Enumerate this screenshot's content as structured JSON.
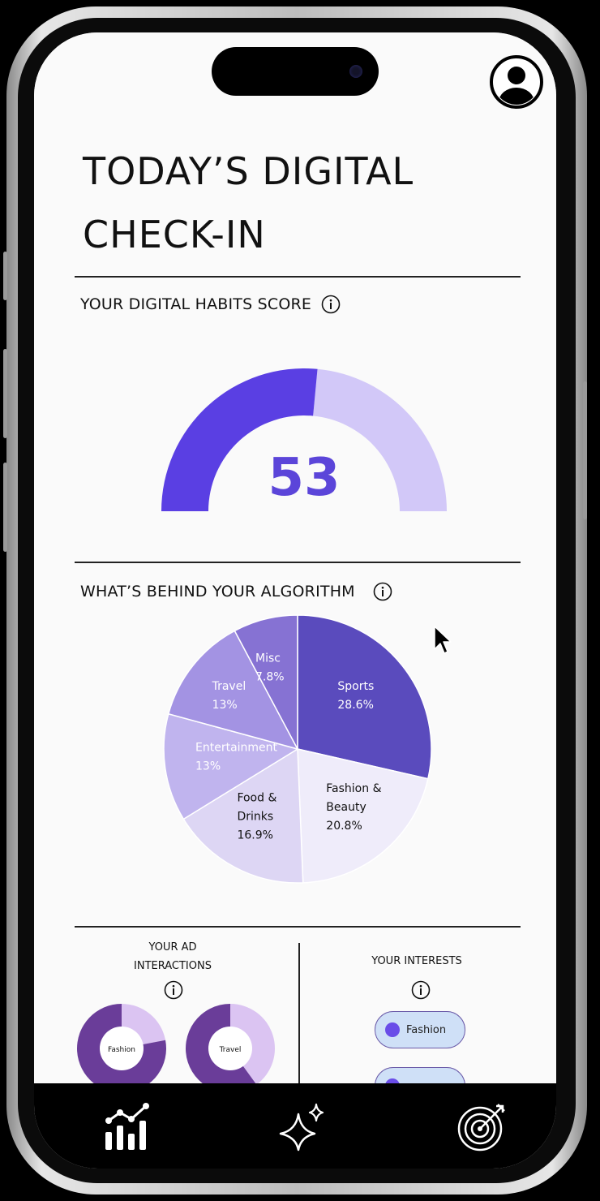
{
  "header": {
    "title_line1": "TODAY’S DIGITAL",
    "title_line2": "CHECK-IN"
  },
  "score_section": {
    "label": "YOUR DIGITAL HABITS SCORE",
    "score": "53",
    "fraction": 0.53,
    "colors": {
      "fill": "#5a3fe3",
      "track": "#d2c8f8"
    }
  },
  "algorithm_section": {
    "label": "WHAT’S BEHIND YOUR ALGORITHM"
  },
  "chart_data": {
    "type": "pie",
    "title": "",
    "slices": [
      {
        "label": [
          "Sports"
        ],
        "pct_label": "28.6%",
        "value": 28.6,
        "color": "#5a4bbd",
        "text_color": "#ffffff"
      },
      {
        "label": [
          "Fashion &",
          "Beauty"
        ],
        "pct_label": "20.8%",
        "value": 20.8,
        "color": "#efecfa",
        "text_color": "#111111"
      },
      {
        "label": [
          "Food &",
          "Drinks"
        ],
        "pct_label": "16.9%",
        "value": 16.9,
        "color": "#ddd6f4",
        "text_color": "#111111"
      },
      {
        "label": [
          "Entertainment"
        ],
        "pct_label": "13%",
        "value": 13,
        "color": "#c0b4ee",
        "text_color": "#ffffff"
      },
      {
        "label": [
          "Travel"
        ],
        "pct_label": "13%",
        "value": 13,
        "color": "#a393e3",
        "text_color": "#ffffff"
      },
      {
        "label": [
          "Misc"
        ],
        "pct_label": "7.8%",
        "value": 7.8,
        "color": "#8672d3",
        "text_color": "#ffffff"
      }
    ]
  },
  "ad_section": {
    "label_line1": "YOUR AD",
    "label_line2": "INTERACTIONS",
    "donuts": [
      {
        "label": "Fashion",
        "fraction": 0.78,
        "color": "#6a3d99",
        "rest": "#dbc4f2"
      },
      {
        "label": "Travel",
        "fraction": 0.6,
        "color": "#6a3d99",
        "rest": "#dbc4f2"
      }
    ]
  },
  "interests_section": {
    "label": "YOUR INTERESTS",
    "pills": [
      {
        "label": "Fashion"
      },
      {
        "label": ""
      }
    ]
  },
  "tabbar": {
    "items": [
      {
        "icon": "analytics-chart-icon"
      },
      {
        "icon": "sparkle-icon"
      },
      {
        "icon": "target-icon"
      }
    ]
  }
}
